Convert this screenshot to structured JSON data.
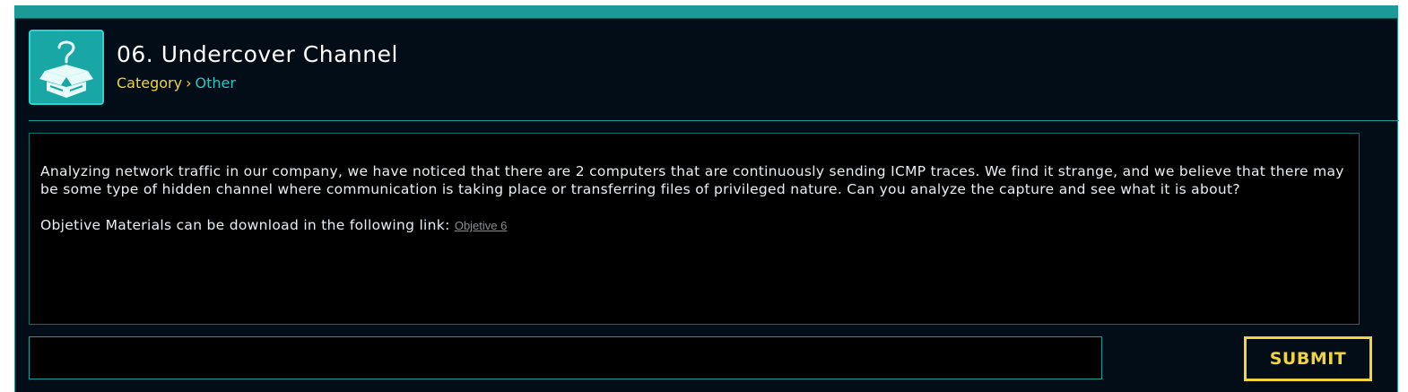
{
  "challenge": {
    "title": "06. Undercover Channel",
    "category_label": "Category",
    "separator": "›",
    "category_value": "Other",
    "icon": "question-box-icon"
  },
  "description": {
    "paragraph": "Analyzing network traffic in our company, we have noticed that there are 2 computers that are continuously sending ICMP traces. We find it strange, and we believe that there may be some type of hidden channel where communication is taking place or transferring files of privileged nature. Can you analyze the capture and see what it is about?",
    "materials_text": "Objetive Materials can be download in the following link: ",
    "link_text": "Objetive 6"
  },
  "answer": {
    "value": "",
    "placeholder": ""
  },
  "submit_label": "SUBMIT",
  "colors": {
    "accent": "#1c9a98",
    "highlight": "#f2d33b",
    "background": "#020d17"
  }
}
